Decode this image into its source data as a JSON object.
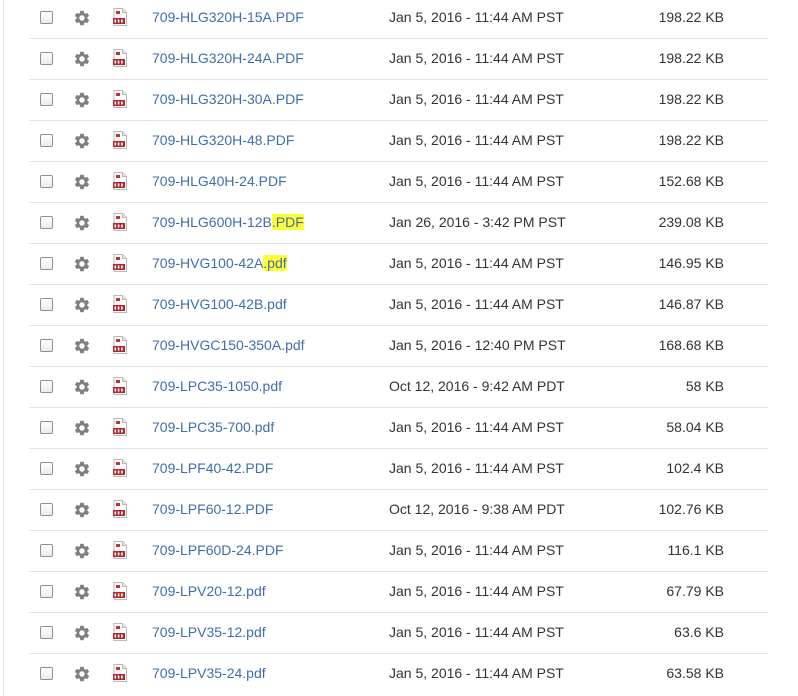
{
  "colors": {
    "link": "#3f6ea7",
    "text": "#333333",
    "highlight": "#ffff37",
    "pdf_icon": "#b1272d",
    "gear_icon": "#7f7f7f",
    "divider": "#e3e3e3"
  },
  "icons": {
    "row_checkbox": "checkbox",
    "row_actions": "gear-icon",
    "file_type": "pdf-file-icon"
  },
  "files": [
    {
      "base": "709-HLG320H-15A",
      "ext": ".PDF",
      "ext_highlighted": false,
      "date": "Jan 5, 2016 - 11:44 AM PST",
      "size": "198.22 KB"
    },
    {
      "base": "709-HLG320H-24A",
      "ext": ".PDF",
      "ext_highlighted": false,
      "date": "Jan 5, 2016 - 11:44 AM PST",
      "size": "198.22 KB"
    },
    {
      "base": "709-HLG320H-30A",
      "ext": ".PDF",
      "ext_highlighted": false,
      "date": "Jan 5, 2016 - 11:44 AM PST",
      "size": "198.22 KB"
    },
    {
      "base": "709-HLG320H-48",
      "ext": ".PDF",
      "ext_highlighted": false,
      "date": "Jan 5, 2016 - 11:44 AM PST",
      "size": "198.22 KB"
    },
    {
      "base": "709-HLG40H-24",
      "ext": ".PDF",
      "ext_highlighted": false,
      "date": "Jan 5, 2016 - 11:44 AM PST",
      "size": "152.68 KB"
    },
    {
      "base": "709-HLG600H-12B",
      "ext": ".PDF",
      "ext_highlighted": true,
      "date": "Jan 26, 2016 - 3:42 PM PST",
      "size": "239.08 KB"
    },
    {
      "base": "709-HVG100-42A",
      "ext": ".pdf",
      "ext_highlighted": true,
      "date": "Jan 5, 2016 - 11:44 AM PST",
      "size": "146.95 KB"
    },
    {
      "base": "709-HVG100-42B",
      "ext": ".pdf",
      "ext_highlighted": false,
      "date": "Jan 5, 2016 - 11:44 AM PST",
      "size": "146.87 KB"
    },
    {
      "base": "709-HVGC150-350A",
      "ext": ".pdf",
      "ext_highlighted": false,
      "date": "Jan 5, 2016 - 12:40 PM PST",
      "size": "168.68 KB"
    },
    {
      "base": "709-LPC35-1050",
      "ext": ".pdf",
      "ext_highlighted": false,
      "date": "Oct 12, 2016 - 9:42 AM PDT",
      "size": "58 KB"
    },
    {
      "base": "709-LPC35-700",
      "ext": ".pdf",
      "ext_highlighted": false,
      "date": "Jan 5, 2016 - 11:44 AM PST",
      "size": "58.04 KB"
    },
    {
      "base": "709-LPF40-42",
      "ext": ".PDF",
      "ext_highlighted": false,
      "date": "Jan 5, 2016 - 11:44 AM PST",
      "size": "102.4 KB"
    },
    {
      "base": "709-LPF60-12",
      "ext": ".PDF",
      "ext_highlighted": false,
      "date": "Oct 12, 2016 - 9:38 AM PDT",
      "size": "102.76 KB"
    },
    {
      "base": "709-LPF60D-24",
      "ext": ".PDF",
      "ext_highlighted": false,
      "date": "Jan 5, 2016 - 11:44 AM PST",
      "size": "116.1 KB"
    },
    {
      "base": "709-LPV20-12",
      "ext": ".pdf",
      "ext_highlighted": false,
      "date": "Jan 5, 2016 - 11:44 AM PST",
      "size": "67.79 KB"
    },
    {
      "base": "709-LPV35-12",
      "ext": ".pdf",
      "ext_highlighted": false,
      "date": "Jan 5, 2016 - 11:44 AM PST",
      "size": "63.6 KB"
    },
    {
      "base": "709-LPV35-24",
      "ext": ".pdf",
      "ext_highlighted": false,
      "date": "Jan 5, 2016 - 11:44 AM PST",
      "size": "63.58 KB"
    }
  ]
}
